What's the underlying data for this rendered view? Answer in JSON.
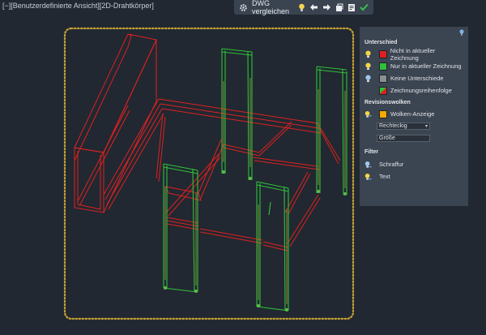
{
  "viewport": {
    "label": "[−][Benutzerdefinierte Ansicht][2D-Drahtkörper]"
  },
  "toolbar": {
    "compare_label": "DWG vergleichen",
    "icons": [
      "gear-icon",
      "bulb-icon",
      "arrow-left-icon",
      "arrow-right-icon",
      "snapshot-icon",
      "export-icon",
      "check-icon"
    ]
  },
  "panel": {
    "section_difference": "Unterschied",
    "items_difference": [
      {
        "label": "Nicht in aktueller Zeichnung",
        "color": "#e02020"
      },
      {
        "label": "Nur in aktueller Zeichnung",
        "color": "#2fc13a"
      },
      {
        "label": "Keine Unterschiede",
        "color": "#8c8f93"
      },
      {
        "label": "Zeichnungsreihenfolge",
        "color": "#2fc13a"
      }
    ],
    "section_revision": "Revisionswolken",
    "cloud_label": "Wolken-Anzeige",
    "cloud_color": "#f5a800",
    "shape_select": "Rechteckig",
    "size_field": "Größe",
    "section_filter": "Filter",
    "filter_items": [
      {
        "label": "Schraffur"
      },
      {
        "label": "Text"
      }
    ]
  },
  "colors": {
    "background": "#212831",
    "red": "#e02020",
    "green": "#2fc13a",
    "cloud": "#c4a033"
  }
}
